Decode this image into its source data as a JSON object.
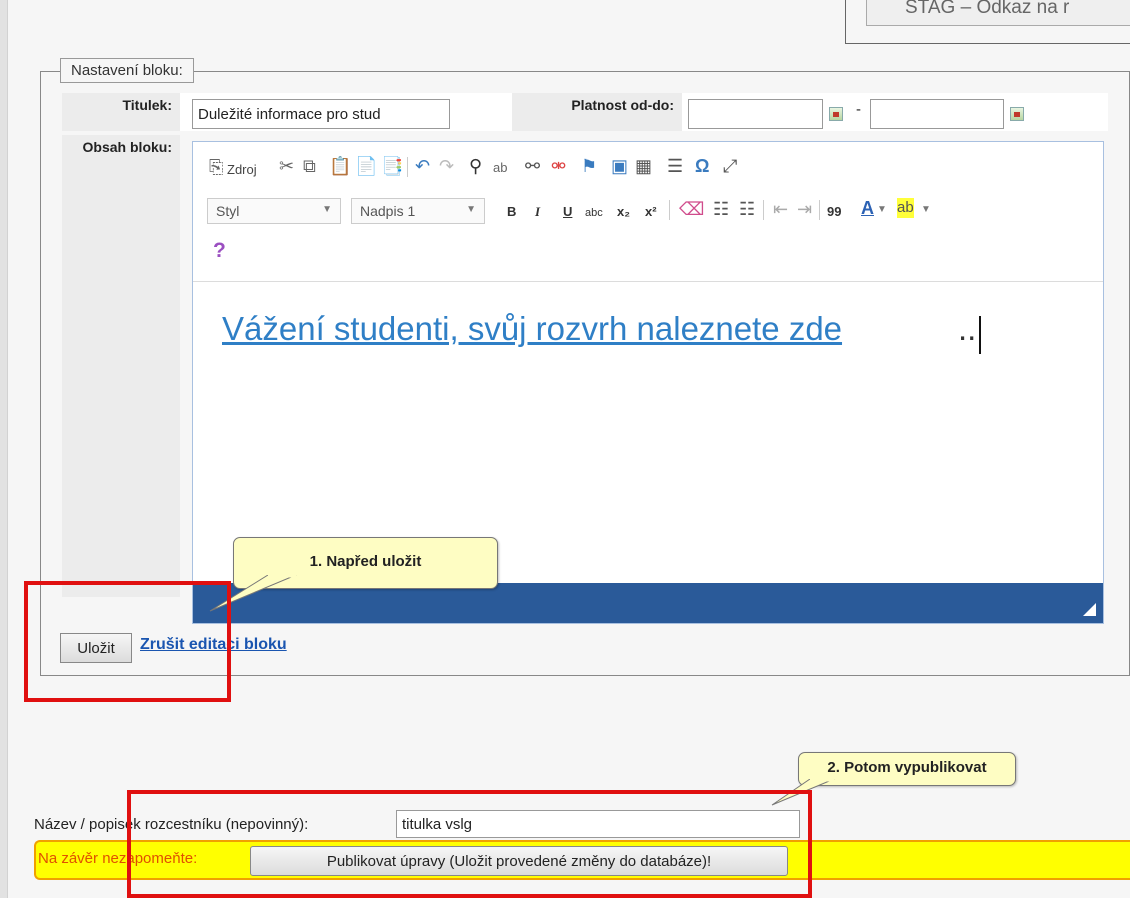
{
  "top_frame_text": "STAG – Odkaz na r",
  "legend": "Nastavení bloku:",
  "titulek": {
    "label": "Titulek:",
    "value": "Duležité informace pro stud"
  },
  "platnost": {
    "label": "Platnost od-do:",
    "dash": "-"
  },
  "obsah": {
    "label": "Obsah bloku:"
  },
  "toolbar": {
    "source_label": "Zdroj",
    "style_select": "Styl",
    "format_select": "Nadpis 1",
    "bold": "B",
    "italic": "I",
    "underline": "U",
    "strike": "abc",
    "subscript": "x₂",
    "superscript": "x²",
    "quote": "99",
    "font_color": "A",
    "omega": "Ω",
    "help": "?"
  },
  "editor": {
    "text": "Vážení studenti, svůj rozvrh naleznete zde",
    "trail": ".."
  },
  "callout1": "1. Napřed uložit",
  "callout2": "2. Potom vypublikovat",
  "buttons": {
    "save": "Uložit",
    "cancel_link": "Zrušit editaci bloku"
  },
  "popis": {
    "label": "Název / popisek rozcestníku (nepovinný):",
    "value": "titulka vslg"
  },
  "warning": {
    "text": "Na závěr nezapomeňte:",
    "publish_button": "Publikovat úpravy (Uložit provedené změny do databáze)!"
  },
  "colors": {
    "link": "#1a55b0",
    "statusbar": "#2a5a99",
    "highlight_box": "#e01010",
    "warning_bar": "#ffff00",
    "callout": "#fefdc3"
  }
}
